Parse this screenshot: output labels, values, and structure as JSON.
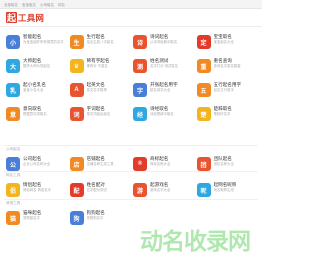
{
  "topbar": {
    "links": [
      "全部取名",
      "宝宝取名",
      "公司取名",
      "网名"
    ]
  },
  "logo": {
    "mark": "起",
    "text": "工具网"
  },
  "sections": [
    {
      "label": "",
      "cards": [
        {
          "title": "智能起名",
          "desc": "为宝宝起好听有寓意的名字",
          "icon": "小",
          "color": "#4a7fd8"
        },
        {
          "title": "生行起名",
          "desc": "结合生辰八字起名",
          "icon": "生",
          "color": "#f08a24"
        },
        {
          "title": "诗词起名",
          "desc": "从诗词经典中取名",
          "icon": "诗",
          "color": "#e8542f"
        },
        {
          "title": "宝宝取名",
          "desc": "宝宝起名大全",
          "icon": "定",
          "color": "#e23b2a"
        },
        {
          "title": "大师起名",
          "desc": "国学大师为您起名",
          "icon": "大",
          "color": "#2fa7e0"
        },
        {
          "title": "稀有字起名",
          "desc": "稀有字 不重名",
          "icon": "♛",
          "color": "#f2b51e"
        },
        {
          "title": "姓名测试",
          "desc": "名字打分 测试姓名",
          "icon": "测",
          "color": "#e8542f"
        },
        {
          "title": "重名查询",
          "desc": "查询名字重名数量",
          "icon": "重",
          "color": "#f08a24"
        },
        {
          "title": "起小名乳名",
          "desc": "宝宝小名大全",
          "icon": "乳",
          "color": "#2fa7e0"
        },
        {
          "title": "起英文名",
          "desc": "英文名字推荐",
          "icon": "A",
          "color": "#e8542f"
        },
        {
          "title": "开张起名用字",
          "desc": "起名用字大全",
          "icon": "字",
          "color": "#4a7fd8"
        },
        {
          "title": "五行起名用字",
          "desc": "起名五行用字",
          "icon": "五",
          "color": "#f08a24"
        },
        {
          "title": "意向取名",
          "desc": "根据意向词取名",
          "icon": "意",
          "color": "#f08a24"
        },
        {
          "title": "字词起名",
          "desc": "按字词组合起名",
          "icon": "词",
          "color": "#e8542f"
        },
        {
          "title": "诗经取名",
          "desc": "诗经楚辞中取名",
          "icon": "经",
          "color": "#2fa7e0"
        },
        {
          "title": "楚辞取名",
          "desc": "楚辞好名字",
          "icon": "楚",
          "color": "#f2b51e"
        }
      ]
    },
    {
      "label": "公司起名",
      "cards": [
        {
          "title": "公司起名",
          "desc": "企业公司名称大全",
          "icon": "公",
          "color": "#4a7fd8"
        },
        {
          "title": "店铺起名",
          "desc": "店铺名称生成工具",
          "icon": "店",
          "color": "#f08a24"
        },
        {
          "title": "商标起名",
          "desc": "商标名称大全",
          "icon": "®",
          "color": "#e23b2a"
        },
        {
          "title": "团队起名",
          "desc": "团队名称大全",
          "icon": "团",
          "color": "#e8542f"
        }
      ]
    },
    {
      "label": "网名工具",
      "cards": [
        {
          "title": "情侣起名",
          "desc": "情侣网名 情侣名字",
          "icon": "侣",
          "color": "#f2b51e"
        },
        {
          "title": "姓名配对",
          "desc": "名字配对测试",
          "icon": "配",
          "color": "#e23b2a"
        },
        {
          "title": "起游戏名",
          "desc": "游戏名字大全",
          "icon": "游",
          "color": "#e8542f"
        },
        {
          "title": "起网名昵称",
          "desc": "网名昵称生成",
          "icon": "昵",
          "color": "#2fa7e0"
        }
      ]
    },
    {
      "label": "其他工具",
      "cards": [
        {
          "title": "猫咪起名",
          "desc": "宠物猫名字",
          "icon": "猫",
          "color": "#f08a24"
        },
        {
          "title": "狗狗起名",
          "desc": "宠物狗名字",
          "icon": "狗",
          "color": "#4a7fd8"
        }
      ]
    }
  ],
  "watermark": "动名收录网"
}
